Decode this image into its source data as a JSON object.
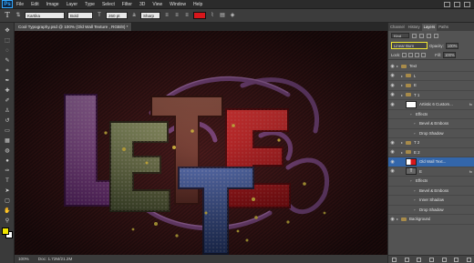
{
  "menubar": {
    "logo": "Ps",
    "items": [
      "File",
      "Edit",
      "Image",
      "Layer",
      "Type",
      "Select",
      "Filter",
      "3D",
      "View",
      "Window",
      "Help"
    ]
  },
  "options": {
    "tool_glyph": "T",
    "font_family": "Kartika",
    "font_style": "Bold",
    "font_size": "260 pt",
    "antialias": "Sharp",
    "text_color": "#d8161b"
  },
  "document": {
    "tab_title": "Cool Typography.psd @ 100% (Old Wall Texture , RGB/8) *",
    "zoom": "100%",
    "doc_size": "Doc: 1.72M/21.2M",
    "artwork_letters": [
      "L",
      "E",
      "T",
      "T",
      "E"
    ]
  },
  "colors": {
    "foreground": "#f2e600",
    "background": "#ffffff",
    "selection": "#3366aa",
    "highlight": "#f0e632"
  },
  "panel": {
    "tabs": [
      "Channel",
      "History",
      "Layers",
      "Paths"
    ],
    "active_tab": "Layers",
    "kind": "Kind",
    "blend_mode": "Linear Burn",
    "opacity_label": "Opacity:",
    "opacity_value": "100%",
    "lock_label": "Lock:",
    "fill_label": "Fill:",
    "fill_value": "100%"
  },
  "layers": [
    {
      "name": "Text",
      "kind": "folder",
      "indent": 0,
      "selected": false,
      "fx": false
    },
    {
      "name": "L",
      "kind": "folder",
      "indent": 1,
      "selected": false,
      "fx": false
    },
    {
      "name": "E",
      "kind": "folder",
      "indent": 1,
      "selected": false,
      "fx": false
    },
    {
      "name": "T 1",
      "kind": "folder",
      "indent": 1,
      "selected": false,
      "fx": false
    },
    {
      "name": "Artistic 6 Custom...",
      "kind": "layer",
      "indent": 2,
      "selected": false,
      "fx": true
    },
    {
      "name": "Effects",
      "kind": "effect",
      "indent": 3,
      "selected": false,
      "fx": false
    },
    {
      "name": "Bevel & Emboss",
      "kind": "effect",
      "indent": 4,
      "selected": false,
      "fx": false
    },
    {
      "name": "Drop Shadow",
      "kind": "effect",
      "indent": 4,
      "selected": false,
      "fx": false
    },
    {
      "name": "T 2",
      "kind": "folder",
      "indent": 1,
      "selected": false,
      "fx": false
    },
    {
      "name": "E 2",
      "kind": "folder",
      "indent": 1,
      "selected": false,
      "fx": false
    },
    {
      "name": "Old Wall Text...",
      "kind": "layer-red",
      "indent": 2,
      "selected": true,
      "fx": false
    },
    {
      "name": "E",
      "kind": "text",
      "indent": 2,
      "selected": false,
      "fx": true
    },
    {
      "name": "Effects",
      "kind": "effect",
      "indent": 3,
      "selected": false,
      "fx": false
    },
    {
      "name": "Bevel & Emboss",
      "kind": "effect",
      "indent": 4,
      "selected": false,
      "fx": false
    },
    {
      "name": "Inner Shadow",
      "kind": "effect",
      "indent": 4,
      "selected": false,
      "fx": false
    },
    {
      "name": "Drop Shadow",
      "kind": "effect",
      "indent": 4,
      "selected": false,
      "fx": false
    },
    {
      "name": "Background",
      "kind": "folder",
      "indent": 0,
      "selected": false,
      "fx": false
    }
  ],
  "icons": {
    "eye": "eye-icon",
    "fx": "fx"
  }
}
